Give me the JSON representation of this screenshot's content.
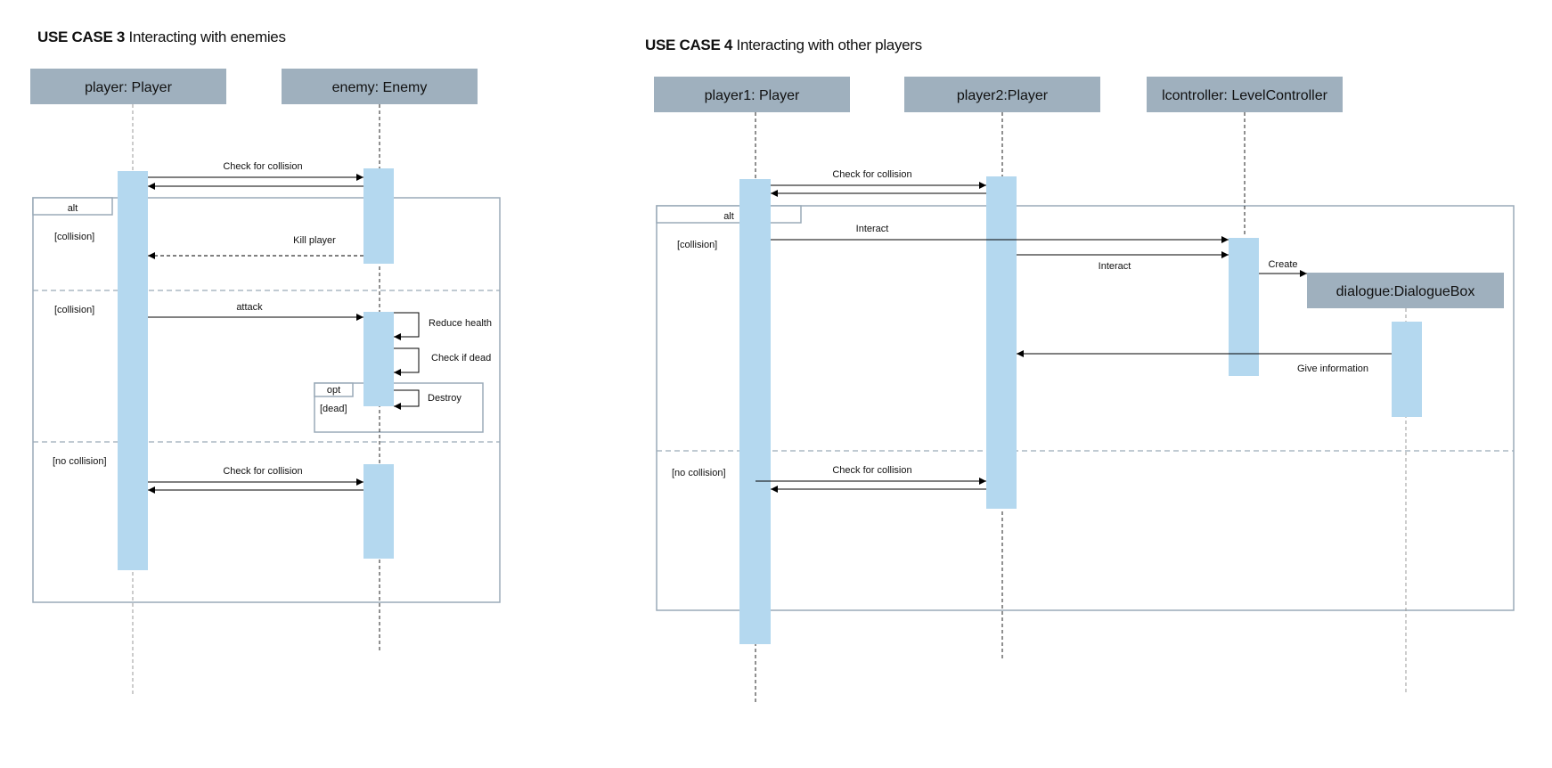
{
  "use_case_3": {
    "title_bold": "USE CASE 3",
    "title_rest": "Interacting with enemies",
    "lifelines": {
      "player": "player: Player",
      "enemy": "enemy: Enemy"
    },
    "frames": {
      "alt": "alt",
      "opt": "opt"
    },
    "guards": {
      "collision_1": "[collision]",
      "collision_2": "[collision]",
      "no_collision": "[no collision]",
      "dead": "[dead]"
    },
    "messages": {
      "check_collision_1": "Check for collision",
      "kill_player": "Kill player",
      "attack": "attack",
      "reduce_health": "Reduce health",
      "check_if_dead": "Check if dead",
      "destroy": "Destroy",
      "check_collision_2": "Check for collision"
    }
  },
  "use_case_4": {
    "title_bold": "USE CASE 4",
    "title_rest": "Interacting with other players",
    "lifelines": {
      "player1": "player1: Player",
      "player2": "player2:Player",
      "lcontroller": "lcontroller: LevelController",
      "dialogue": "dialogue:DialogueBox"
    },
    "frames": {
      "alt": "alt"
    },
    "guards": {
      "collision": "[collision]",
      "no_collision": "[no collision]"
    },
    "messages": {
      "check_collision_1": "Check for collision",
      "interact_1": "Interact",
      "interact_2": "Interact",
      "create": "Create",
      "give_information": "Give information",
      "check_collision_2": "Check for collision"
    }
  },
  "colors": {
    "header": "#9fb0be",
    "activation": "#b4d8ef",
    "frame": "#9aaab8",
    "line": "#000000"
  }
}
